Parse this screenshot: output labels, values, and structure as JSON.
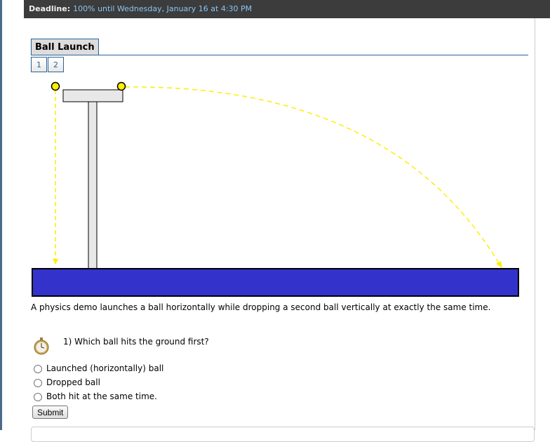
{
  "deadline": {
    "label": "Deadline:",
    "value": "100% until Wednesday, January 16 at 4:30 PM"
  },
  "tab": {
    "title": "Ball Launch"
  },
  "pages": [
    "1",
    "2"
  ],
  "simulation": {
    "ball_color": "#ffee00",
    "ground_color": "#3333cc",
    "path_color": "#ffee00"
  },
  "description": "A physics demo launches a ball horizontally while dropping a second ball vertically at exactly the same time.",
  "question": {
    "number": "1)",
    "text": "Which ball hits the ground first?",
    "icon": "stopwatch-icon",
    "options": [
      "Launched (horizontally) ball",
      "Dropped ball",
      "Both hit at the same time."
    ],
    "submit_label": "Submit"
  }
}
